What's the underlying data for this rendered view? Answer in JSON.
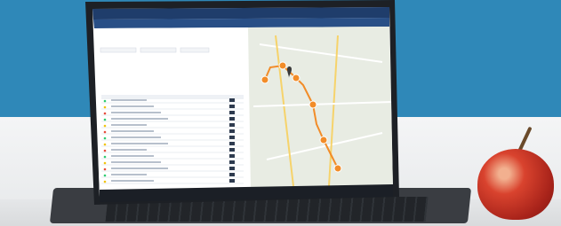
{
  "app": {
    "tabs": [
      {
        "label": ""
      },
      {
        "label": ""
      },
      {
        "label": ""
      }
    ],
    "list": {
      "rows": 14
    }
  },
  "map": {
    "marker_color": "#f28c28",
    "route_color": "#f28c28"
  },
  "scene": {
    "background_top": "#2f88b8",
    "background_bottom": "#f4f5f6",
    "apple_color": "#c2382a"
  }
}
